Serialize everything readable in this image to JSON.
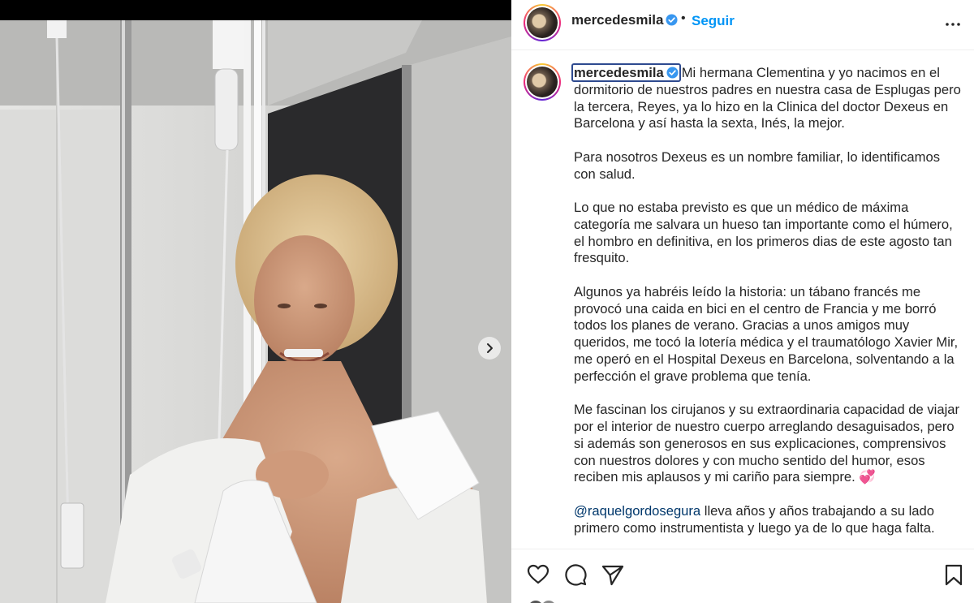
{
  "post": {
    "username": "mercedesmila",
    "follow_label": "Seguir",
    "separator": "•"
  },
  "caption": {
    "username": "mercedesmila",
    "paragraphs": [
      "Mi hermana Clementina y yo nacimos en el dormitorio de nuestros padres en nuestra casa de Esplugas pero la tercera, Reyes, ya lo hizo en la Clinica del doctor Dexeus en Barcelona y así hasta la sexta, Inés, la mejor.",
      "Para nosotros Dexeus es un nombre familiar, lo identificamos con salud.",
      "Lo que no estaba previsto es que un médico de máxima categoría me salvara un hueso tan importante como el húmero, el hombro en definitiva, en los primeros dias de este agosto tan fresquito.",
      "Algunos ya habréis leído la historia: un tábano francés me provocó una caida en bici en el centro de Francia y me borró todos los planes de verano. Gracias a unos amigos muy queridos, me tocó la lotería médica y el traumatólogo Xavier Mir, me operó en el Hospital Dexeus en Barcelona, solventando a la perfección el grave problema que tenía.",
      "Me fascinan los cirujanos y su extraordinaria capacidad de viajar por el interior de nuestro cuerpo arreglando desaguisados, pero si además son generosos en sus explicaciones, comprensivos con nuestros dolores y con mucho sentido del humor, esos reciben mis aplausos y mi cariño para siempre. 💞"
    ],
    "mention": "@raquelgordosegura",
    "mention_text": " lleva años y años trabajando a su lado primero como instrumentista y luego ya de lo que haga falta."
  },
  "icons": {
    "verified": "verified-badge-icon",
    "more": "more-options-icon",
    "next": "chevron-right-icon",
    "like": "heart-icon",
    "comment": "comment-icon",
    "share": "send-icon",
    "save": "bookmark-icon"
  },
  "colors": {
    "accent": "#0095f6",
    "verified": "#3897f0",
    "mention": "#00376b",
    "text": "#262626"
  }
}
